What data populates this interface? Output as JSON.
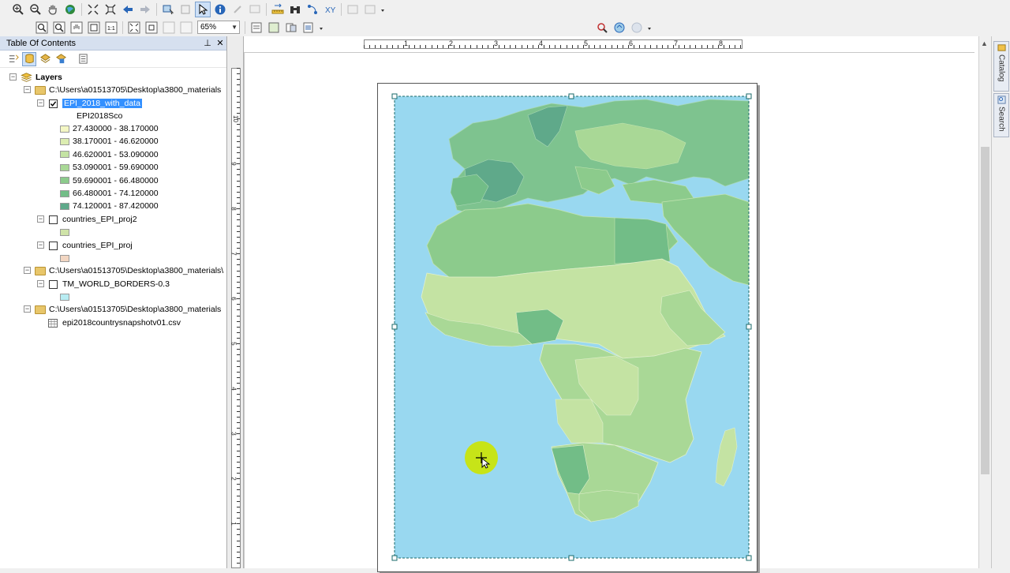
{
  "toolbar": {
    "zoom_level": "65%"
  },
  "toc": {
    "title": "Table Of Contents",
    "pin_icon": "pin-icon",
    "close_icon": "close-icon",
    "root_label": "Layers",
    "group1_path": "C:\\Users\\a01513705\\Desktop\\a3800_materials",
    "layer_epi": "EPI_2018_with_data",
    "epi_field": "EPI2018Sco",
    "classes": [
      {
        "label": "27.430000 - 38.170000",
        "color": "#f4f7c4"
      },
      {
        "label": "38.170001 - 46.620000",
        "color": "#dcedb1"
      },
      {
        "label": "46.620001 - 53.090000",
        "color": "#c4e3a3"
      },
      {
        "label": "53.090001 - 59.690000",
        "color": "#a9d896"
      },
      {
        "label": "59.690001 - 66.480000",
        "color": "#8ccb8c"
      },
      {
        "label": "66.480001 - 74.120000",
        "color": "#72bd87"
      },
      {
        "label": "74.120001 - 87.420000",
        "color": "#5fa98a"
      }
    ],
    "layer_proj2": "countries_EPI_proj2",
    "proj2_color": "#cfe3a8",
    "layer_proj": "countries_EPI_proj",
    "proj_color": "#f2d6c2",
    "group2_path": "C:\\Users\\a01513705\\Desktop\\a3800_materials\\",
    "layer_world": "TM_WORLD_BORDERS-0.3",
    "world_color": "#b8ecf2",
    "group3_path": "C:\\Users\\a01513705\\Desktop\\a3800_materials",
    "table_name": "epi2018countrysnapshotv01.csv"
  },
  "rulers": {
    "h_labels": [
      "1",
      "2",
      "3",
      "4",
      "5",
      "6",
      "7",
      "8"
    ],
    "v_labels": [
      "10",
      "9",
      "8",
      "7",
      "6",
      "5",
      "4",
      "3",
      "2",
      "1"
    ]
  },
  "side_tabs": {
    "catalog": "Catalog",
    "search": "Search"
  },
  "colors": {
    "ocean": "#99d8f0",
    "selection": "#3390ff"
  }
}
